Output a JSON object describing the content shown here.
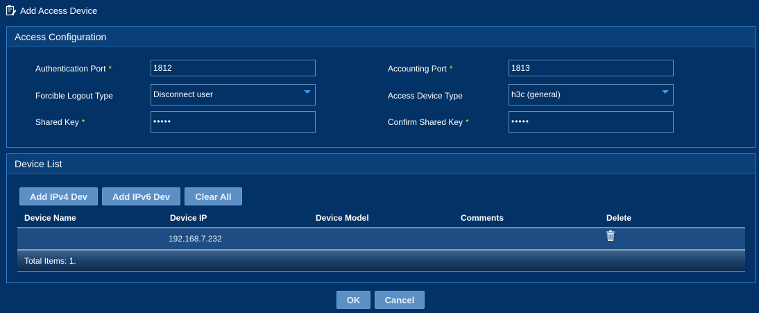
{
  "window": {
    "title": "Add Access Device"
  },
  "access_config": {
    "header": "Access Configuration",
    "auth_port": {
      "label": "Authentication Port",
      "value": "1812"
    },
    "acct_port": {
      "label": "Accounting Port",
      "value": "1813"
    },
    "logout_type": {
      "label": "Forcible Logout Type",
      "value": "Disconnect user"
    },
    "device_type": {
      "label": "Access Device Type",
      "value": "h3c (general)"
    },
    "shared_key": {
      "label": "Shared Key",
      "value": "•••••"
    },
    "confirm_key": {
      "label": "Confirm Shared Key",
      "value": "•••••"
    },
    "required_mark": "*"
  },
  "device_list": {
    "header": "Device List",
    "buttons": {
      "add_ipv4": "Add IPv4 Dev",
      "add_ipv6": "Add IPv6 Dev",
      "clear_all": "Clear All"
    },
    "columns": [
      "Device Name",
      "Device IP",
      "Device Model",
      "Comments",
      "Delete"
    ],
    "rows": [
      {
        "device_name": "",
        "device_ip": "192.168.7.232",
        "device_model": "",
        "comments": ""
      }
    ],
    "total": "Total Items: 1."
  },
  "actions": {
    "ok": "OK",
    "cancel": "Cancel"
  },
  "colors": {
    "background": "#033266",
    "panel_border": "#2f7cc9",
    "button": "#5c8fc3",
    "required": "#ffd23c"
  }
}
